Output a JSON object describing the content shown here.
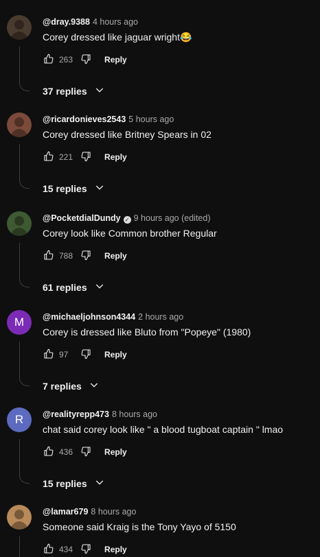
{
  "comments": [
    {
      "author": "@dray.9388",
      "time": "4 hours ago",
      "verified": false,
      "edited": "",
      "text": "Corey dressed like jaguar wright😂",
      "likes": "263",
      "reply_label": "Reply",
      "replies_label": "37 replies",
      "avatar": {
        "type": "photo",
        "letter": "",
        "color": "#4a3b2f"
      }
    },
    {
      "author": "@ricardonieves2543",
      "time": "5 hours ago",
      "verified": false,
      "edited": "",
      "text": "Corey dressed like Britney Spears in 02",
      "likes": "221",
      "reply_label": "Reply",
      "replies_label": "15 replies",
      "avatar": {
        "type": "photo",
        "letter": "",
        "color": "#7a4a3a"
      }
    },
    {
      "author": "@PocketdialDundy",
      "time": "9 hours ago (edited)",
      "verified": true,
      "edited": "",
      "text": "Corey look like Common brother Regular",
      "likes": "788",
      "reply_label": "Reply",
      "replies_label": "61 replies",
      "avatar": {
        "type": "photo",
        "letter": "",
        "color": "#3f5a32"
      }
    },
    {
      "author": "@michaeljohnson4344",
      "time": "2 hours ago",
      "verified": false,
      "edited": "",
      "text": "Corey is dressed like Bluto from \"Popeye\" (1980)",
      "likes": "97",
      "reply_label": "Reply",
      "replies_label": "7 replies",
      "avatar": {
        "type": "letter",
        "letter": "M",
        "color": "#7b2bb5"
      }
    },
    {
      "author": "@realityrepp473",
      "time": "8 hours ago",
      "verified": false,
      "edited": "",
      "text": "chat said corey look like \" a blood tugboat captain \" lmao",
      "likes": "436",
      "reply_label": "Reply",
      "replies_label": "15 replies",
      "avatar": {
        "type": "letter",
        "letter": "R",
        "color": "#5c6bc0"
      }
    },
    {
      "author": "@lamar679",
      "time": "8 hours ago",
      "verified": false,
      "edited": "",
      "text": "Someone said Kraig is the Tony Yayo of 5150",
      "likes": "434",
      "reply_label": "Reply",
      "replies_label": "",
      "avatar": {
        "type": "photo",
        "letter": "",
        "color": "#b88a5a"
      }
    }
  ]
}
